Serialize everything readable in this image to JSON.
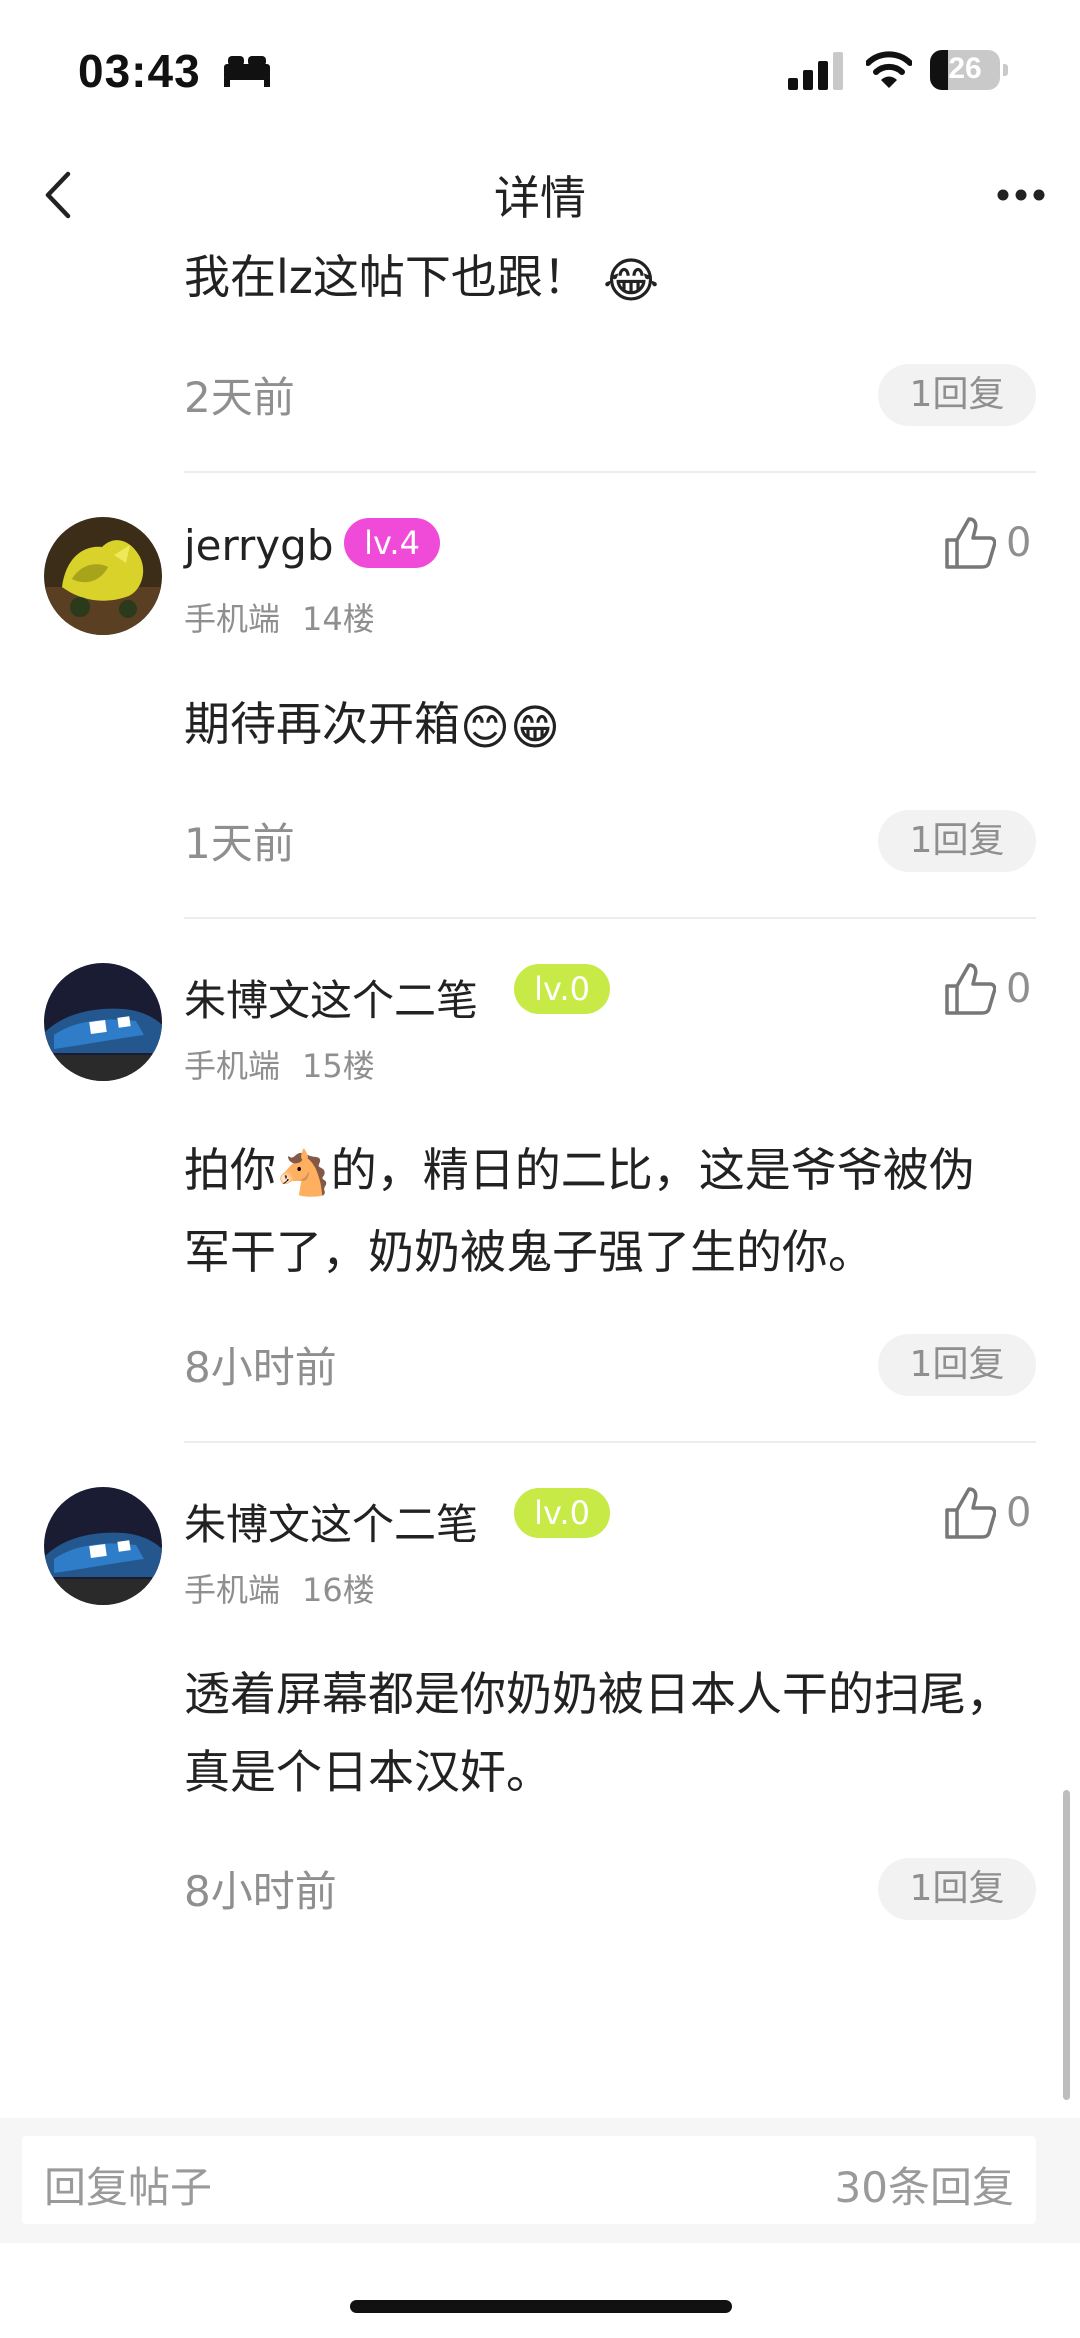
{
  "status_bar": {
    "time": "03:43",
    "battery_level": "26",
    "battery_fraction": 0.26
  },
  "nav": {
    "title": "详情"
  },
  "comments": [
    {
      "text": "我在lz这帖下也跟！",
      "text_emoji": "😂",
      "time": "2天前",
      "reply_label": "1回复"
    },
    {
      "username": "jerrygb",
      "level": "lv.4",
      "level_color": "#f04bd8",
      "client": "手机端",
      "floor": "14楼",
      "likes": "0",
      "text": "期待再次开箱",
      "text_emoji": "😊😁",
      "time": "1天前",
      "reply_label": "1回复"
    },
    {
      "username": "朱博文这个二笔",
      "level": "lv.0",
      "level_color": "#c7ea46",
      "client": "手机端",
      "floor": "15楼",
      "likes": "0",
      "text_a": "拍你",
      "text_emoji": "🐴",
      "text_b": "的，精日的二比，这是爷爷被伪军干了，奶奶被鬼子强了生的你。",
      "time": "8小时前",
      "reply_label": "1回复"
    },
    {
      "username": "朱博文这个二笔",
      "level": "lv.0",
      "level_color": "#c7ea46",
      "client": "手机端",
      "floor": "16楼",
      "likes": "0",
      "text": "透着屏幕都是你奶奶被日本人干的扫尾，真是个日本汉奸。",
      "time": "8小时前",
      "reply_label": "1回复"
    }
  ],
  "bottom_bar": {
    "placeholder": "回复帖子",
    "reply_count": "30条回复"
  },
  "icons": {
    "back": "chevron-left-icon",
    "more": "more-dots-icon",
    "like": "thumbs-up-icon"
  }
}
